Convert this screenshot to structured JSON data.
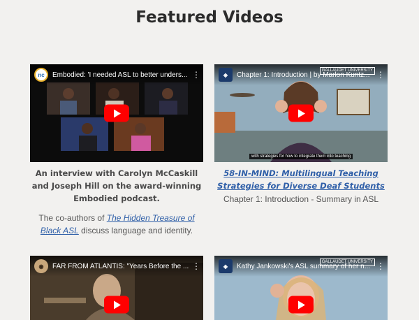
{
  "page": {
    "title": "Featured Videos"
  },
  "videos": [
    {
      "title": "Embodied: 'I needed ASL to better unders...",
      "channel_icon": "ecnc-logo-icon"
    },
    {
      "title": "Chapter 1: Introduction | by Marlon Kuntz...",
      "channel_icon": "gallaudet-logo-icon",
      "badge": "GALLAUDET UNIVERSITY",
      "caption": "with strategies for how to integrate them into teaching"
    },
    {
      "title": "FAR FROM ATLANTIS: \"Years Before the ...",
      "channel_icon": "channel-avatar-icon"
    },
    {
      "title": "Kathy Jankowski's ASL summary of her n...",
      "channel_icon": "gallaudet-logo-icon",
      "badge": "GALLAUDET UNIVERSITY"
    }
  ],
  "descriptions": [
    {
      "bold": "An interview with Carolyn McCaskill and Joseph Hill on the award-winning Embodied podcast.",
      "sub_prefix": "The co-authors of ",
      "sub_link": "The Hidden Treasure of Black ASL",
      "sub_suffix": " discuss language and identity."
    },
    {
      "link": "58-IN-MIND: Multilingual Teaching Strategies for Diverse Deaf Students",
      "sub": "Chapter 1: Introduction - Summary in ASL"
    }
  ],
  "colors": {
    "background": "#f2f1ef",
    "link": "#2f5fa8",
    "play_button": "#ff0000"
  }
}
